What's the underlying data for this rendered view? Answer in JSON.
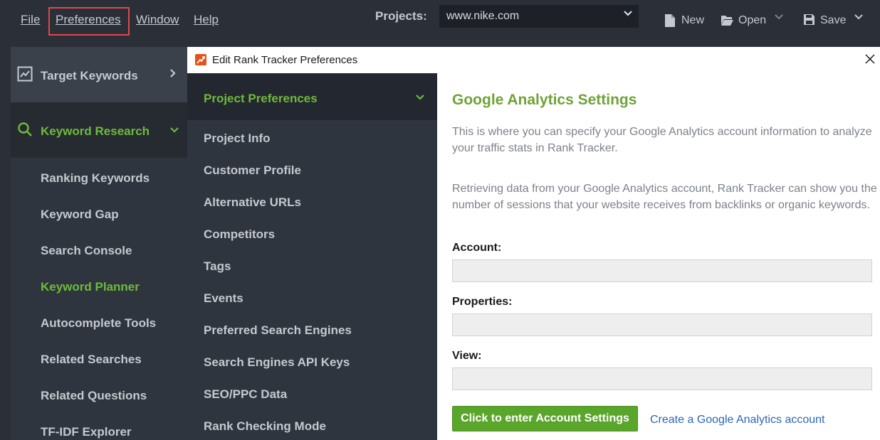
{
  "menubar": {
    "items": [
      "File",
      "Preferences",
      "Window",
      "Help"
    ]
  },
  "toolbar": {
    "projects_label": "Projects:",
    "project_value": "www.nike.com",
    "new_label": "New",
    "open_label": "Open",
    "save_label": "Save"
  },
  "sidebar": {
    "sections": [
      {
        "label": "Target Keywords",
        "icon": "trend-chart-icon",
        "state": "collapsed"
      },
      {
        "label": "Keyword Research",
        "icon": "search-icon",
        "state": "expanded"
      }
    ],
    "items": [
      {
        "label": "Ranking Keywords",
        "active": false
      },
      {
        "label": "Keyword Gap",
        "active": false
      },
      {
        "label": "Search Console",
        "active": false
      },
      {
        "label": "Keyword Planner",
        "active": true
      },
      {
        "label": "Autocomplete Tools",
        "active": false
      },
      {
        "label": "Related Searches",
        "active": false
      },
      {
        "label": "Related Questions",
        "active": false
      },
      {
        "label": "TF-IDF Explorer",
        "active": false
      }
    ]
  },
  "dialog": {
    "title": "Edit Rank Tracker Preferences",
    "nav": {
      "header": "Project Preferences",
      "items": [
        "Project Info",
        "Customer Profile",
        "Alternative URLs",
        "Competitors",
        "Tags",
        "Events",
        "Preferred Search Engines",
        "Search Engines API Keys",
        "SEO/PPC Data",
        "Rank Checking Mode"
      ]
    },
    "content": {
      "title": "Google Analytics Settings",
      "description": "This is where you can specify your Google Analytics account information to analyze your traffic stats in Rank Tracker.",
      "info": "Retrieving data from your Google Analytics account, Rank Tracker can show you the number of sessions that your website receives from backlinks or organic keywords.",
      "account_label": "Account:",
      "account_value": "",
      "properties_label": "Properties:",
      "properties_value": "",
      "view_label": "View:",
      "view_value": "",
      "button_label": "Click to enter Account Settings",
      "link_label": "Create a Google Analytics account"
    }
  },
  "colors": {
    "accent_green": "#6fba3b",
    "button_green": "#5aa62a",
    "highlight_red": "#e0474c",
    "link_blue": "#2c66b8"
  }
}
